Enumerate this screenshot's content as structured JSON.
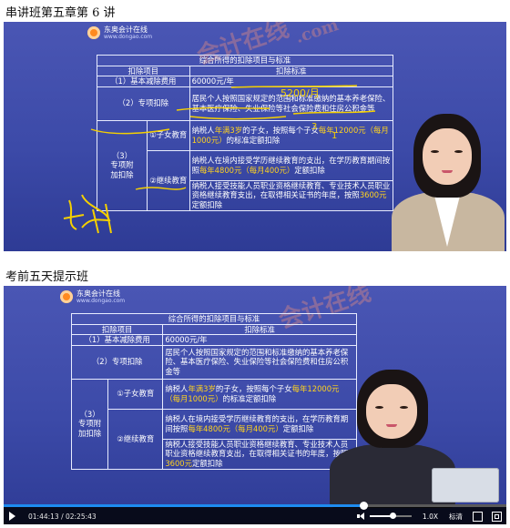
{
  "captions": {
    "top": "串讲班第五章第 6 讲",
    "bottom": "考前五天提示班"
  },
  "logo": {
    "name": "东奥会计在线",
    "url": "www.dongao.com"
  },
  "watermark": {
    "text": "会计在线",
    "subtext": ".com"
  },
  "table": {
    "title": "综合所得的扣除项目与标准",
    "headers": [
      "扣除项目",
      "扣除标准"
    ],
    "basic": {
      "label": "（1）基本减除费用",
      "value": "60000元/年"
    },
    "special": {
      "label": "（2）专项扣除",
      "value": "居民个人按照国家规定的范围和标准缴纳的基本养老保险、基本医疗保险、失业保险等社会保险费和住房公积金等"
    },
    "additional": {
      "label_line1": "（3）",
      "label_line2": "专项附",
      "label_line3": "加扣除",
      "child": {
        "label": "①子女教育",
        "text_pre": "纳税人",
        "hl1": "年满3岁",
        "text_mid": "的子女，按照每个子女",
        "hl2": "每年12000元（每月1000元）",
        "text_post": "的标准定额扣除"
      },
      "continuing": {
        "label": "②继续教育",
        "p1_pre": "纳税人在境内接受学历继续教育的支出，在学历教育期间按照",
        "p1_hl": "每年4800元（每月400元）",
        "p1_post": "定额扣除",
        "p2_pre": "纳税人接受技能人员职业资格继续教育、专业技术人员职业资格继续教育支出，在取得相关证书的年度，按照",
        "p2_hl": "3600元",
        "p2_post": "定额扣除"
      }
    }
  },
  "annotations": {
    "note1": "5200/月",
    "note2": "3",
    "note3": "1"
  },
  "player": {
    "time": "01:44:13 / 02:25:43",
    "progress": 0.715,
    "volume": 0.55,
    "speed": "1.0X",
    "quality": "标清"
  },
  "colors": {
    "highlight": "#ffd21f",
    "stage": "#3c4aa8",
    "progress": "#1e8cf0",
    "ink": "#f5d000"
  }
}
